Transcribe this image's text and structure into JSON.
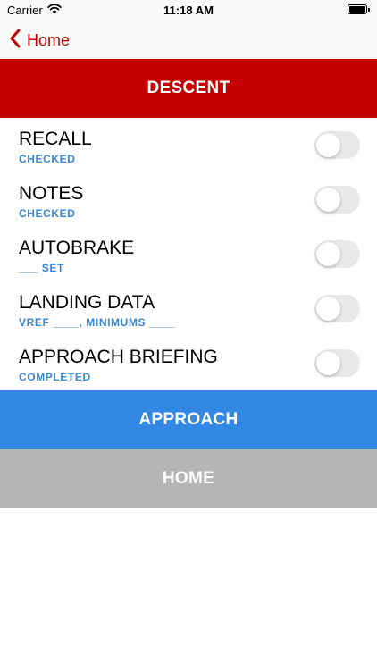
{
  "status_bar": {
    "carrier": "Carrier",
    "time": "11:18 AM",
    "wifi_icon": "wifi-icon",
    "battery_icon": "battery-icon"
  },
  "nav": {
    "back_label": "Home",
    "back_icon": "chevron-left-icon",
    "accent_color": "#bf0000"
  },
  "banner": {
    "title": "DESCENT",
    "color": "#c40000"
  },
  "checklist": {
    "items": [
      {
        "title": "RECALL",
        "subtitle": "CHECKED",
        "toggle_on": false
      },
      {
        "title": "NOTES",
        "subtitle": "CHECKED",
        "toggle_on": false
      },
      {
        "title": "AUTOBRAKE",
        "subtitle": "___ SET",
        "toggle_on": false
      },
      {
        "title": "LANDING DATA",
        "subtitle": "VREF ____, MINIMUMS ____",
        "toggle_on": false
      },
      {
        "title": "APPROACH BRIEFING",
        "subtitle": "COMPLETED",
        "toggle_on": false
      }
    ],
    "subtitle_color": "#3a86d0"
  },
  "buttons": {
    "approach_label": "APPROACH",
    "approach_color": "#3388e3",
    "home_label": "HOME",
    "home_color": "#b5b5b5"
  }
}
